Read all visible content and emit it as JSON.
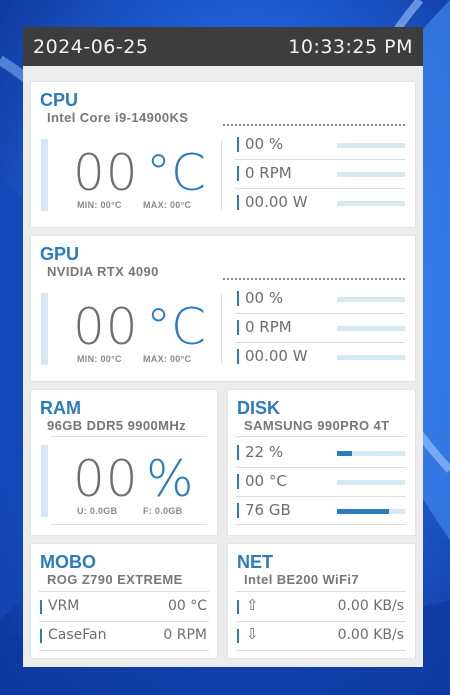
{
  "header": {
    "date": "2024-06-25",
    "time": "10:33:25 PM"
  },
  "cpu": {
    "title": "CPU",
    "model": "Intel Core i9-14900KS",
    "temp": "00",
    "temp_unit": "°C",
    "min": "MIN: 00°C",
    "max": "MAX: 00°C",
    "metrics": [
      {
        "text": "00 %",
        "fill": 0
      },
      {
        "text": "0 RPM",
        "fill": 0
      },
      {
        "text": "00.00 W",
        "fill": 0
      }
    ]
  },
  "gpu": {
    "title": "GPU",
    "model": "NVIDIA RTX 4090",
    "temp": "00",
    "temp_unit": "°C",
    "min": "MIN: 00°C",
    "max": "MAX: 00°C",
    "metrics": [
      {
        "text": "00 %",
        "fill": 0
      },
      {
        "text": "0 RPM",
        "fill": 0
      },
      {
        "text": "00.00 W",
        "fill": 0
      }
    ]
  },
  "ram": {
    "title": "RAM",
    "model": "96GB DDR5 9900MHz",
    "usage": "00",
    "usage_unit": "%",
    "used": "U: 0.0GB",
    "free": "F: 0.0GB"
  },
  "disk": {
    "title": "DISK",
    "model": "SAMSUNG 990PRO 4T",
    "metrics": [
      {
        "text": "22 %",
        "fill": 0.22
      },
      {
        "text": "00 °C",
        "fill": 0
      },
      {
        "text": "76 GB",
        "fill": 0.76
      }
    ]
  },
  "mobo": {
    "title": "MOBO",
    "model": "ROG Z790 EXTREME",
    "rows": [
      {
        "label": "VRM",
        "value": "00 °C"
      },
      {
        "label": "CaseFan",
        "value": "0 RPM"
      }
    ]
  },
  "net": {
    "title": "NET",
    "model": "Intel BE200 WiFi7",
    "rows": [
      {
        "icon": "⇧",
        "value": "0.00 KB/s"
      },
      {
        "icon": "⇩",
        "value": "0.00 KB/s"
      }
    ]
  },
  "colors": {
    "accent": "#2b7bc0",
    "track": "#d7e8f5",
    "topbar": "#3d3d3d"
  }
}
